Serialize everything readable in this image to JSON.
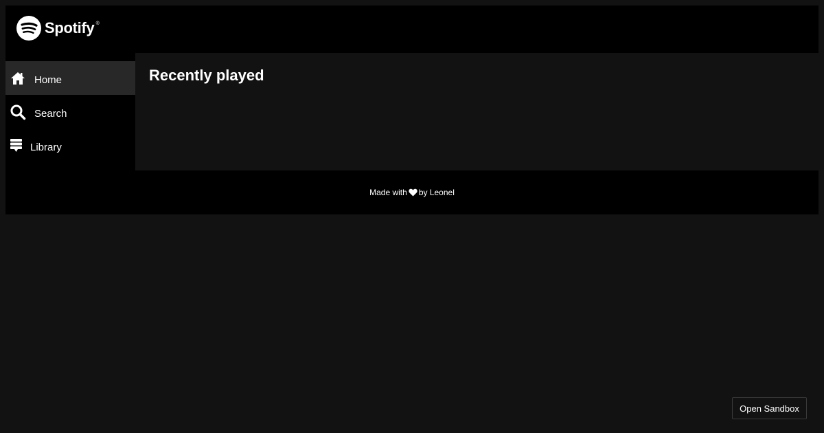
{
  "brand": {
    "name": "Spotify",
    "trademark": "®",
    "logo_icon": "spotify-logo-icon"
  },
  "sidebar": {
    "items": [
      {
        "label": "Home",
        "icon": "home-icon",
        "active": true
      },
      {
        "label": "Search",
        "icon": "search-icon",
        "active": false
      },
      {
        "label": "Library",
        "icon": "library-icon",
        "active": false
      }
    ]
  },
  "main": {
    "title": "Recently played"
  },
  "footer": {
    "prefix": "Made with",
    "icon": "heart-icon",
    "suffix": "by Leonel"
  },
  "sandbox": {
    "label": "Open Sandbox"
  },
  "colors": {
    "page_bg": "#121212",
    "frame_bg": "#000000",
    "active_item_bg": "#282828",
    "text": "#ffffff"
  }
}
